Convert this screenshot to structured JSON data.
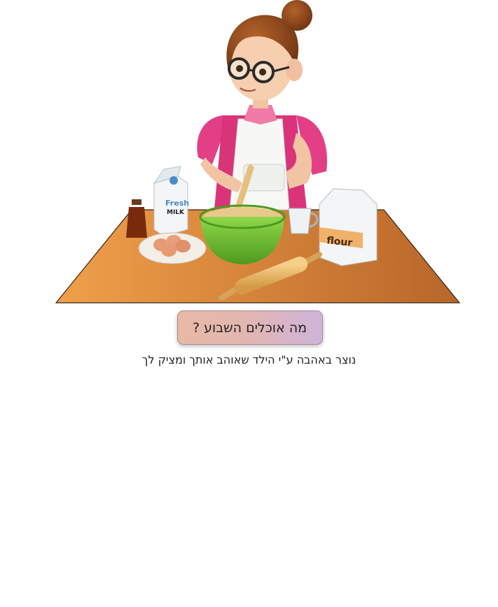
{
  "hero": {
    "milk_carton_text_1": "Fresh",
    "milk_carton_text_2": "MILK",
    "flour_bag_text": "flour"
  },
  "cta": {
    "label": "מה אוכלים השבוע ?"
  },
  "footer": {
    "credit": "נוצר באהבה ע\"י הילד שאוהב אותך ומציק לך"
  },
  "colors": {
    "button_gradient_start": "#e9b9a4",
    "button_gradient_end": "#cfb3da",
    "table": "#d8843a",
    "shirt": "#e23f86",
    "bowl": "#7bc63a"
  }
}
